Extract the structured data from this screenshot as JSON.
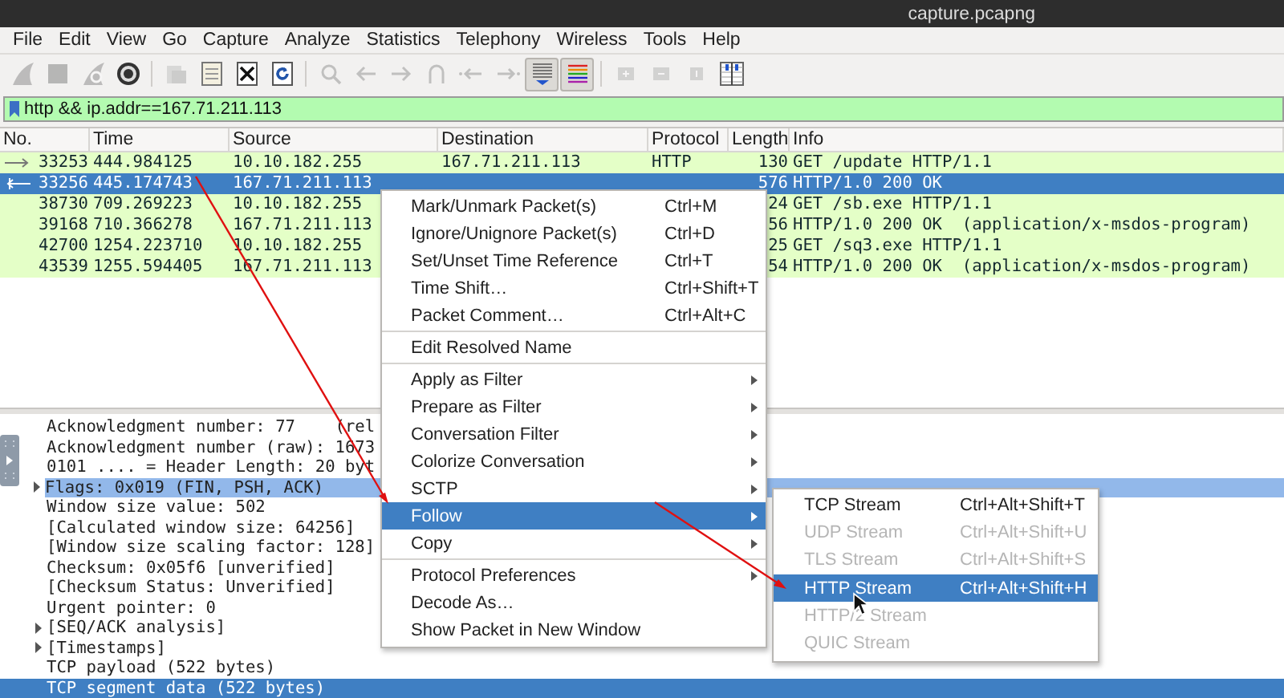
{
  "window": {
    "title": "capture.pcapng"
  },
  "menu_bar": [
    "File",
    "Edit",
    "View",
    "Go",
    "Capture",
    "Analyze",
    "Statistics",
    "Telephony",
    "Wireless",
    "Tools",
    "Help"
  ],
  "toolbar": [
    {
      "kind": "start",
      "disabled": true,
      "pressed": false
    },
    {
      "kind": "stop",
      "disabled": true,
      "pressed": false
    },
    {
      "kind": "restart",
      "disabled": true,
      "pressed": false
    },
    {
      "kind": "options",
      "disabled": false,
      "pressed": false
    },
    {
      "kind": "separator"
    },
    {
      "kind": "open",
      "disabled": true,
      "pressed": false
    },
    {
      "kind": "save",
      "disabled": false,
      "pressed": false
    },
    {
      "kind": "close",
      "disabled": false,
      "pressed": false
    },
    {
      "kind": "reload",
      "disabled": false,
      "pressed": false
    },
    {
      "kind": "separator"
    },
    {
      "kind": "search",
      "disabled": true,
      "pressed": false
    },
    {
      "kind": "back",
      "disabled": true,
      "pressed": false
    },
    {
      "kind": "forward",
      "disabled": true,
      "pressed": false
    },
    {
      "kind": "jump",
      "disabled": true,
      "pressed": false
    },
    {
      "kind": "first",
      "disabled": true,
      "pressed": false
    },
    {
      "kind": "last",
      "disabled": true,
      "pressed": false
    },
    {
      "kind": "autoscroll",
      "disabled": false,
      "pressed": true
    },
    {
      "kind": "colorize",
      "disabled": false,
      "pressed": true
    },
    {
      "kind": "separator"
    },
    {
      "kind": "zoom-in",
      "disabled": true,
      "pressed": false
    },
    {
      "kind": "zoom-out",
      "disabled": true,
      "pressed": false
    },
    {
      "kind": "zoom-reset",
      "disabled": true,
      "pressed": false
    },
    {
      "kind": "resize-columns",
      "disabled": false,
      "pressed": false
    }
  ],
  "display_filter": {
    "value": "http && ip.addr==167.71.211.113"
  },
  "packet_list": {
    "columns": [
      "No.",
      "Time",
      "Source",
      "Destination",
      "Protocol",
      "Length",
      "Info"
    ],
    "rows": [
      {
        "kind": "request",
        "selected": false,
        "no": "33253",
        "time": "444.984125",
        "source": "10.10.182.255",
        "destination": "167.71.211.113",
        "protocol": "HTTP",
        "length": "130",
        "info": "GET /update HTTP/1.1"
      },
      {
        "kind": "response",
        "selected": true,
        "no": "33256",
        "time": "445.174743",
        "source": "167.71.211.113",
        "length": "576",
        "info": "HTTP/1.0 200 OK"
      },
      {
        "kind": "plain",
        "selected": false,
        "no": "38730",
        "time": "709.269223",
        "source": "10.10.182.255",
        "length": "24",
        "info": "GET /sb.exe HTTP/1.1"
      },
      {
        "kind": "plain",
        "selected": false,
        "no": "39168",
        "time": "710.366278",
        "source": "167.71.211.113",
        "length": "56",
        "info": "HTTP/1.0 200 OK  (application/x-msdos-program)"
      },
      {
        "kind": "plain",
        "selected": false,
        "no": "42700",
        "time": "1254.223710",
        "source": "10.10.182.255",
        "length": "25",
        "info": "GET /sq3.exe HTTP/1.1"
      },
      {
        "kind": "plain",
        "selected": false,
        "no": "43539",
        "time": "1255.594405",
        "source": "167.71.211.113",
        "length": "54",
        "info": "HTTP/1.0 200 OK  (application/x-msdos-program)"
      }
    ]
  },
  "packet_details": [
    {
      "text": "Acknowledgment number: 77    (rel",
      "kind": "leaf",
      "hovered": false,
      "selected": false
    },
    {
      "text": "Acknowledgment number (raw): 1673",
      "kind": "leaf",
      "hovered": false,
      "selected": false
    },
    {
      "text": "0101 .... = Header Length: 20 byt",
      "kind": "leaf",
      "hovered": false,
      "selected": false
    },
    {
      "text": "Flags: 0x019 (FIN, PSH, ACK)",
      "kind": "branch",
      "hovered": true,
      "selected": false
    },
    {
      "text": "Window size value: 502",
      "kind": "leaf",
      "hovered": false,
      "selected": false
    },
    {
      "text": "[Calculated window size: 64256]",
      "kind": "leaf",
      "hovered": false,
      "selected": false
    },
    {
      "text": "[Window size scaling factor: 128]",
      "kind": "leaf",
      "hovered": false,
      "selected": false
    },
    {
      "text": "Checksum: 0x05f6 [unverified]",
      "kind": "leaf",
      "hovered": false,
      "selected": false
    },
    {
      "text": "[Checksum Status: Unverified]",
      "kind": "leaf",
      "hovered": false,
      "selected": false
    },
    {
      "text": "Urgent pointer: 0",
      "kind": "leaf",
      "hovered": false,
      "selected": false
    },
    {
      "text": "[SEQ/ACK analysis]",
      "kind": "branch",
      "hovered": false,
      "selected": false
    },
    {
      "text": "[Timestamps]",
      "kind": "branch",
      "hovered": false,
      "selected": false
    },
    {
      "text": "TCP payload (522 bytes)",
      "kind": "leaf",
      "hovered": false,
      "selected": false
    },
    {
      "text": "TCP segment data (522 bytes)",
      "kind": "leaf",
      "hovered": false,
      "selected": true
    }
  ],
  "context_menu": {
    "items": [
      {
        "kind": "item",
        "label": "Mark/Unmark Packet(s)",
        "shortcut": "Ctrl+M",
        "submenu": false,
        "selected": false
      },
      {
        "kind": "item",
        "label": "Ignore/Unignore Packet(s)",
        "shortcut": "Ctrl+D",
        "submenu": false,
        "selected": false
      },
      {
        "kind": "item",
        "label": "Set/Unset Time Reference",
        "shortcut": "Ctrl+T",
        "submenu": false,
        "selected": false
      },
      {
        "kind": "item",
        "label": "Time Shift…",
        "shortcut": "Ctrl+Shift+T",
        "submenu": false,
        "selected": false
      },
      {
        "kind": "item",
        "label": "Packet Comment…",
        "shortcut": "Ctrl+Alt+C",
        "submenu": false,
        "selected": false
      },
      {
        "kind": "separator"
      },
      {
        "kind": "item",
        "label": "Edit Resolved Name",
        "submenu": false,
        "selected": false
      },
      {
        "kind": "separator"
      },
      {
        "kind": "item",
        "label": "Apply as Filter",
        "submenu": true,
        "selected": false
      },
      {
        "kind": "item",
        "label": "Prepare as Filter",
        "submenu": true,
        "selected": false
      },
      {
        "kind": "item",
        "label": "Conversation Filter",
        "submenu": true,
        "selected": false
      },
      {
        "kind": "item",
        "label": "Colorize Conversation",
        "submenu": true,
        "selected": false
      },
      {
        "kind": "item",
        "label": "SCTP",
        "submenu": true,
        "selected": false
      },
      {
        "kind": "item",
        "label": "Follow",
        "submenu": true,
        "selected": true
      },
      {
        "kind": "item",
        "label": "Copy",
        "submenu": true,
        "selected": false
      },
      {
        "kind": "separator"
      },
      {
        "kind": "item",
        "label": "Protocol Preferences",
        "submenu": true,
        "selected": false
      },
      {
        "kind": "item",
        "label": "Decode As…",
        "submenu": false,
        "selected": false
      },
      {
        "kind": "item",
        "label": "Show Packet in New Window",
        "submenu": false,
        "selected": false
      }
    ]
  },
  "follow_submenu": {
    "items": [
      {
        "label": "TCP Stream",
        "shortcut": "Ctrl+Alt+Shift+T",
        "disabled": false,
        "selected": false
      },
      {
        "label": "UDP Stream",
        "shortcut": "Ctrl+Alt+Shift+U",
        "disabled": true,
        "selected": false
      },
      {
        "label": "TLS Stream",
        "shortcut": "Ctrl+Alt+Shift+S",
        "disabled": true,
        "selected": false
      },
      {
        "label": "HTTP Stream",
        "shortcut": "Ctrl+Alt+Shift+H",
        "disabled": false,
        "selected": true
      },
      {
        "label": "HTTP/2 Stream",
        "disabled": true,
        "selected": false
      },
      {
        "label": "QUIC Stream",
        "disabled": true,
        "selected": false
      }
    ]
  }
}
